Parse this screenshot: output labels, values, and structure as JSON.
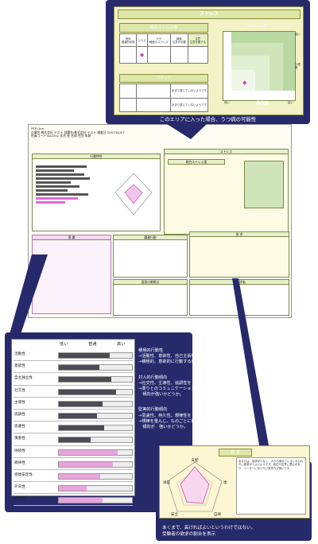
{
  "brand": {
    "navy": "#262a6b",
    "panel_green": "#f3f1c6",
    "accent_magenta": "#d63fbf"
  },
  "callout_stress": {
    "title": "ストレス",
    "table_title": "総合ストレス度",
    "cols": [
      "良好",
      "ふつう",
      "やや",
      "軽度",
      "注意"
    ],
    "col_sub": [
      "健康的状態",
      "",
      "軽度のストレス",
      "注意が必要",
      "注意を要する"
    ],
    "comment_title": "コメント",
    "row1": "身体面",
    "row2": "心理面",
    "row_text": "あまり感じていないようです",
    "chart_title": "＜ストレス度＞",
    "ylabel": "高い",
    "ylabel2": "心理面",
    "xlabel": "身体面",
    "xlabel2": "低い",
    "xlabel3": "高い",
    "caption": "このエリアに入った場合、うつ病の可能性"
  },
  "mini": {
    "header_lines": [
      "PSP One",
      "企業名 株式会社 テスト 部署名/株式会社 テスト 検査日 2007/02/07",
      "社員コード AA1001 氏名 姓 名前 性別 年齢"
    ],
    "p1": "行動特性",
    "p2": "ストレス",
    "p3": "総合ストレス度",
    "p4": "適 職",
    "p5": "職務行動",
    "p6": "欲 求",
    "p7": "自己評価",
    "p8": "面接の着眼点"
  },
  "callout_behavior": {
    "hdr_low": "低い",
    "hdr_avg": "普通",
    "hdr_high": "高い",
    "rows": [
      {
        "label": "活動性",
        "desc": "",
        "value": 0.7
      },
      {
        "label": "意欲性",
        "desc": "",
        "value": 0.55
      },
      {
        "label": "自主独立性",
        "desc": "",
        "value": 0.72
      },
      {
        "label": "社交性",
        "desc": "",
        "value": 0.78
      },
      {
        "label": "主導性",
        "desc": "",
        "value": 0.6
      },
      {
        "label": "協調性",
        "desc": "",
        "value": 0.52
      },
      {
        "label": "思慮性",
        "desc": "",
        "value": 0.62
      },
      {
        "label": "慎重性",
        "desc": "",
        "value": 0.44
      },
      {
        "label": "持続性",
        "desc": "",
        "value": 0.8
      },
      {
        "label": "規律性",
        "desc": "",
        "value": 0.74
      },
      {
        "label": "感情安定性",
        "desc": "",
        "value": 0.56
      },
      {
        "label": "外向性",
        "desc": "",
        "value": 0.38
      },
      {
        "label": "自律性",
        "desc": "",
        "value": 0.6
      }
    ],
    "text_blocks": [
      {
        "head": "積極的行動性",
        "lines": [
          "→活動性、意欲性、自己主張性をトータルで表現",
          "→積極的、意欲的に行動する傾向が強いかどうか"
        ]
      },
      {
        "head": "対人的行動傾向",
        "lines": [
          "→社交性、主導性、協調性をトータルで表現",
          "→周りとのコミュニケーション、社交性などの",
          "　傾向が強いかどうか。"
        ]
      },
      {
        "head": "堅実的行動傾向",
        "lines": [
          "→思慮性、持久性、規律性をトータルで表現",
          "→規律を重んじ、ものごとに粘り強く対応できる",
          "　傾向が　強いかどうか。"
        ]
      }
    ]
  },
  "callout_desire": {
    "title": "欲 求",
    "axis": [
      "支配",
      "達成",
      "自律",
      "安全",
      "承認"
    ],
    "note_lines": [
      "あなたは、欲求が少なく、人から優れているとみられたい欲求がつよいようです。地位や名誉に関心があり、リーダーになりたい気持ちが強いです。"
    ],
    "foot": [
      "あくまで、高ければよいというわけではない。",
      "受験者の欲求の割合を表示"
    ]
  }
}
